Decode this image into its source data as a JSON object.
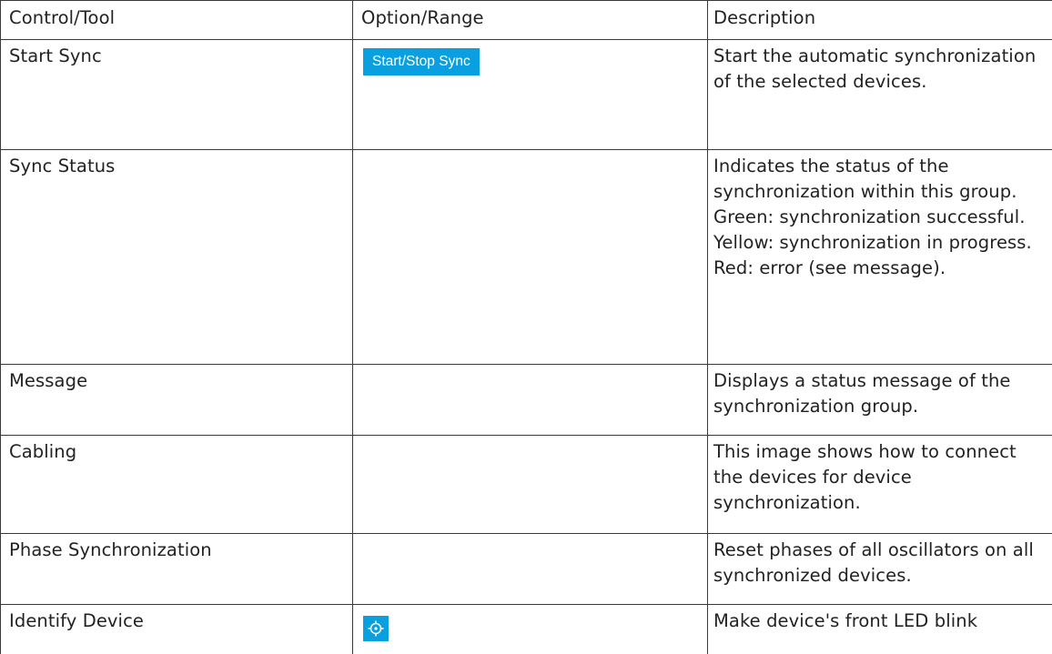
{
  "header": {
    "col1": "Control/Tool",
    "col2": "Option/Range",
    "col3": "Description"
  },
  "rows": [
    {
      "control": "Start Sync",
      "option_button": "Start/Stop Sync",
      "description": "Start the automatic synchronization of the selected devices."
    },
    {
      "control": "Sync Status",
      "description": "Indicates the status of the synchronization within this group. Green: synchronization successful. Yellow: synchronization in progress. Red: error (see message)."
    },
    {
      "control": "Message",
      "description": "Displays a status message of the synchronization group."
    },
    {
      "control": "Cabling",
      "description": "This image shows how to connect the devices for device synchronization."
    },
    {
      "control": "Phase Synchronization",
      "description": "Reset phases of all oscillators on all synchronized devices."
    },
    {
      "control": "Identify Device",
      "option_icon": "crosshair-locate-icon",
      "description": "Make device's front LED blink"
    }
  ],
  "colors": {
    "button_bg": "#0aa0e0",
    "button_text": "#ffffff",
    "border": "#3a3a3a"
  }
}
